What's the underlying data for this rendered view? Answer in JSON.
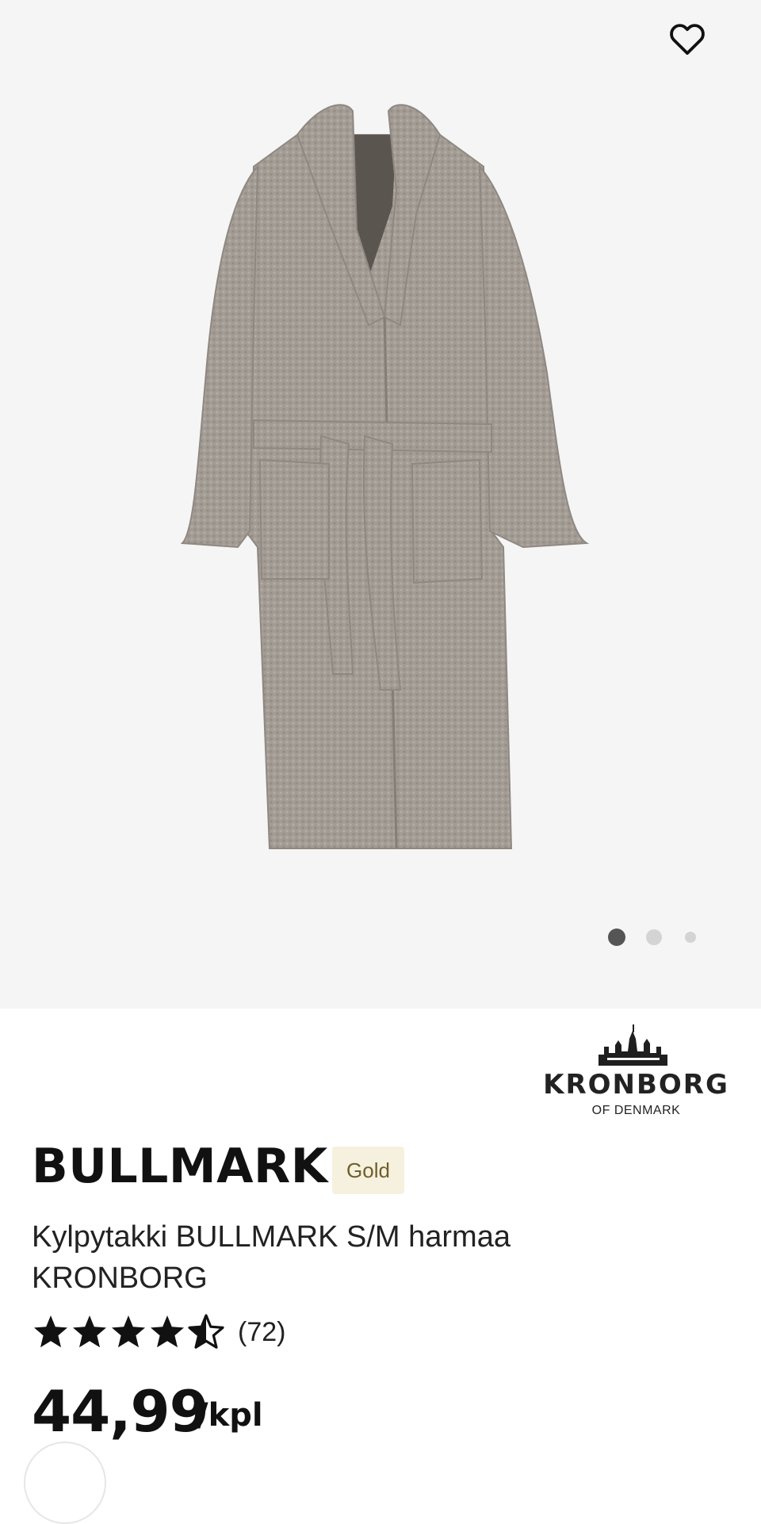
{
  "product": {
    "title": "BULLMARK",
    "badge": "Gold",
    "subtitle": "Kylpytakki BULLMARK S/M harmaa KRONBORG",
    "rating": {
      "value": 4.5,
      "max": 5,
      "count_label": "(72)"
    },
    "price": "44,99",
    "unit": "/kpl"
  },
  "brand": {
    "name": "KRONBORG",
    "sub": "OF DENMARK"
  },
  "gallery": {
    "image_count": 3,
    "active_index": 0
  },
  "icons": {
    "favorite": "heart-outline-icon",
    "star_full": "star-filled-icon",
    "star_half": "star-half-icon"
  },
  "colors": {
    "gallery_bg": "#f5f5f5",
    "badge_bg": "#f6f1de",
    "badge_text": "#6e5e2a",
    "robe": "#a39c95"
  }
}
